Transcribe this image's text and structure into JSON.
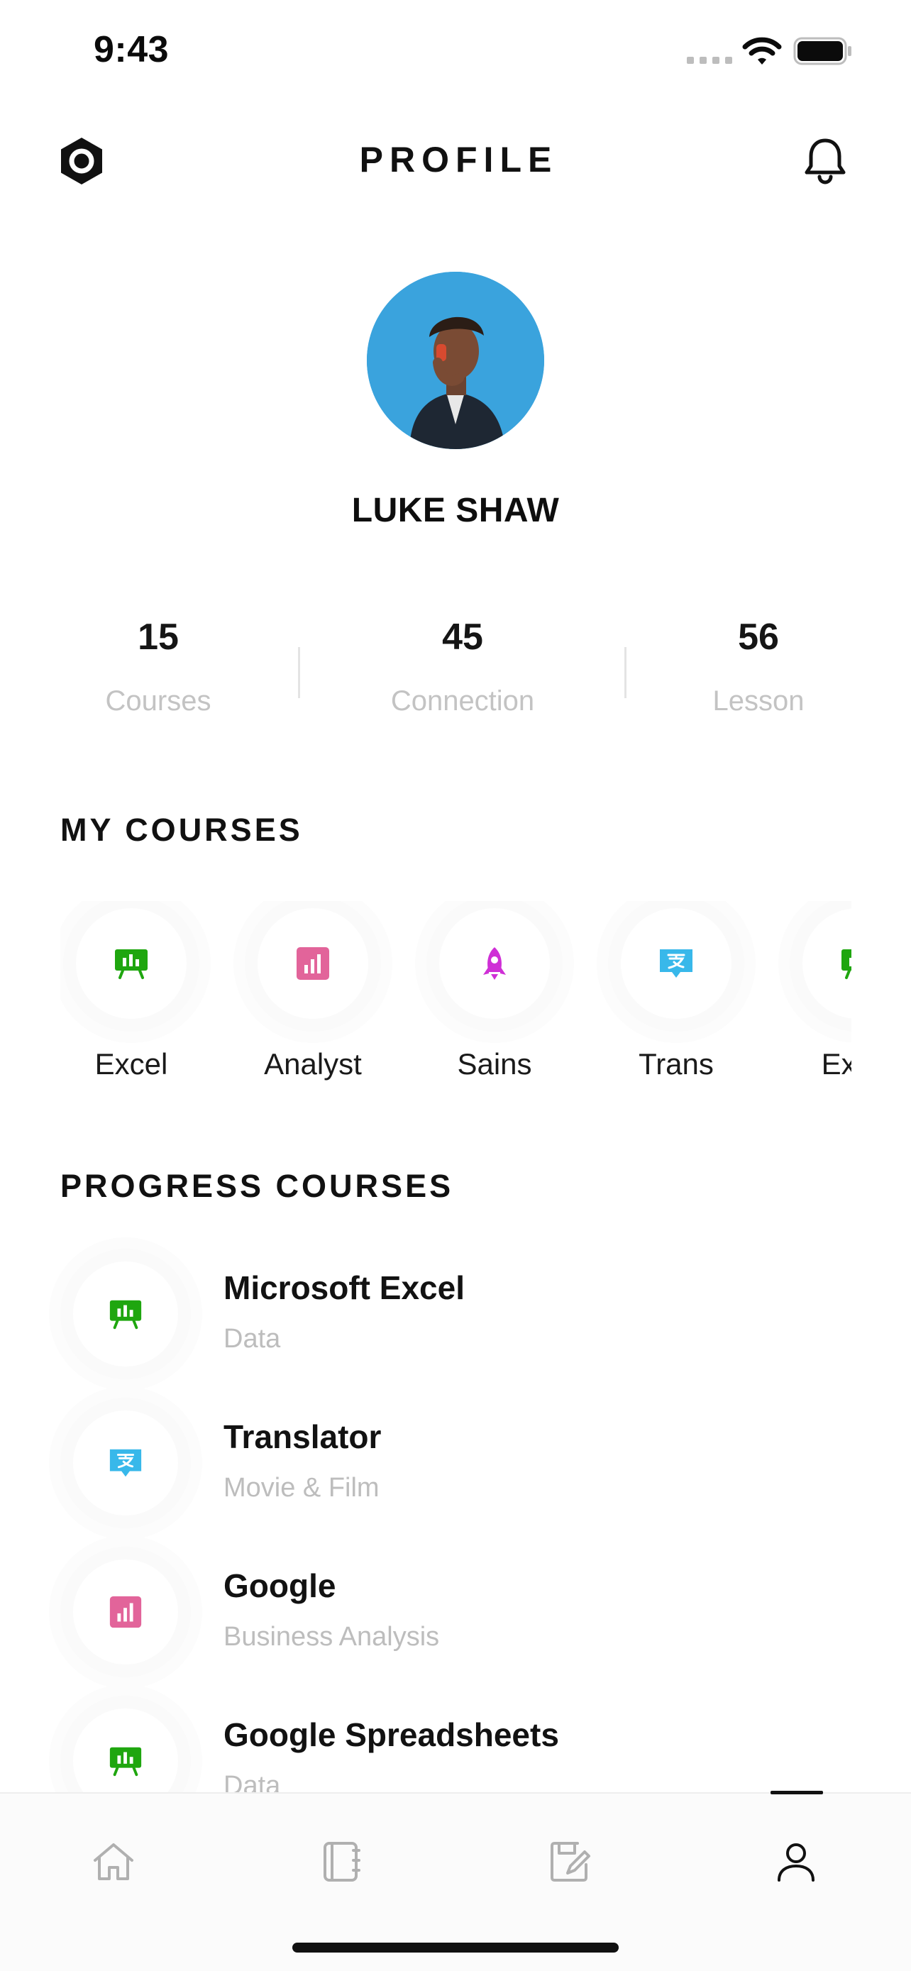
{
  "status_bar": {
    "time": "9:43"
  },
  "header": {
    "title": "PROFILE"
  },
  "profile": {
    "name": "LUKE SHAW"
  },
  "stats": [
    {
      "value": "15",
      "label": "Courses"
    },
    {
      "value": "45",
      "label": "Connection"
    },
    {
      "value": "56",
      "label": "Lesson"
    }
  ],
  "my_courses": {
    "title": "MY COURSES",
    "items": [
      {
        "label": "Excel",
        "icon": "presentation-chart-icon",
        "color": "#1fa60f"
      },
      {
        "label": "Analyst",
        "icon": "bar-chart-icon",
        "color": "#e2649a"
      },
      {
        "label": "Sains",
        "icon": "rocket-icon",
        "color": "#cf2fd6"
      },
      {
        "label": "Trans",
        "icon": "translate-icon",
        "color": "#38b8ea"
      },
      {
        "label": "Excel",
        "icon": "presentation-chart-icon",
        "color": "#1fa60f"
      }
    ]
  },
  "progress_courses": {
    "title": "PROGRESS COURSES",
    "items": [
      {
        "title": "Microsoft Excel",
        "subtitle": "Data",
        "icon": "presentation-chart-icon",
        "color": "#1fa60f"
      },
      {
        "title": "Translator",
        "subtitle": "Movie & Film",
        "icon": "translate-icon",
        "color": "#38b8ea"
      },
      {
        "title": "Google",
        "subtitle": "Business Analysis",
        "icon": "bar-chart-icon",
        "color": "#e2649a"
      },
      {
        "title": "Google Spreadsheets",
        "subtitle": "Data",
        "icon": "presentation-chart-icon",
        "color": "#1fa60f"
      }
    ]
  },
  "tabbar": {
    "tabs": [
      {
        "name": "home",
        "icon": "home-icon"
      },
      {
        "name": "notebook",
        "icon": "notebook-icon"
      },
      {
        "name": "edit-notes",
        "icon": "edit-note-icon"
      },
      {
        "name": "profile",
        "icon": "user-icon",
        "active": true
      }
    ]
  }
}
